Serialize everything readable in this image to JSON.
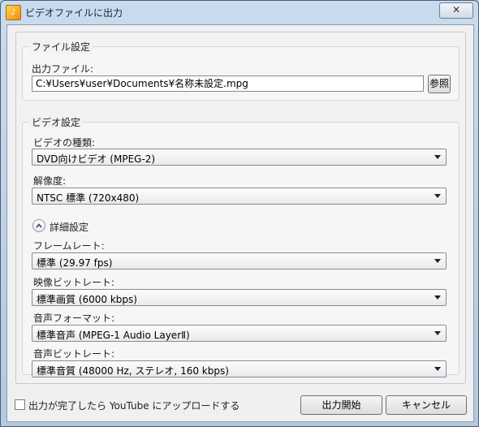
{
  "window": {
    "title": "ビデオファイルに出力",
    "icon": "app-icon",
    "close_glyph": "✕"
  },
  "file_settings": {
    "title": "ファイル設定",
    "output_label": "出力ファイル:",
    "output_value": "C:¥Users¥user¥Documents¥名称未設定.mpg",
    "browse_label": "参照"
  },
  "video_settings": {
    "title": "ビデオ設定",
    "type_label": "ビデオの種類:",
    "type_value": "DVD向けビデオ (MPEG-2)",
    "resolution_label": "解像度:",
    "resolution_value": "NTSC 標準 (720x480)",
    "advanced_label": "詳細設定",
    "framerate_label": "フレームレート:",
    "framerate_value": "標準 (29.97 fps)",
    "video_bitrate_label": "映像ビットレート:",
    "video_bitrate_value": "標準画質 (6000 kbps)",
    "audio_format_label": "音声フォーマット:",
    "audio_format_value": "標準音声 (MPEG-1 Audio LayerⅡ)",
    "audio_bitrate_label": "音声ビットレート:",
    "audio_bitrate_value": "標準音質 (48000 Hz, ステレオ, 160 kbps)"
  },
  "footer": {
    "youtube_checkbox_label": "出力が完了したら YouTube にアップロードする",
    "youtube_checked": false,
    "start_button": "出力開始",
    "cancel_button": "キャンセル"
  }
}
